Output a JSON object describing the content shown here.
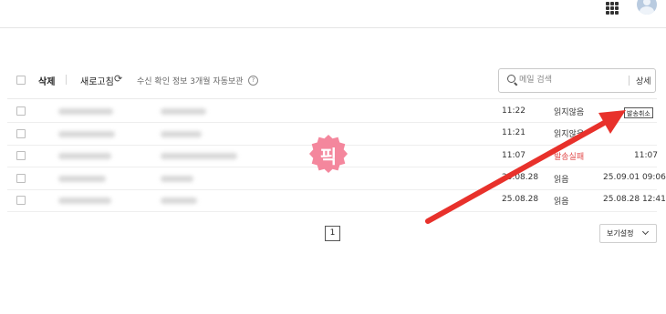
{
  "toolbar": {
    "delete_label": "삭제",
    "refresh_label": "새로고침",
    "refresh_icon": "⟳",
    "info_text": "수신 확인 정보 3개월 자동보관",
    "help_icon": "?"
  },
  "search": {
    "placeholder": "메일 검색",
    "detail_label": "상세"
  },
  "rows": [
    {
      "time": "11:22",
      "status": "읽지않음",
      "read_time": "",
      "action": "발송취소"
    },
    {
      "time": "11:21",
      "status": "읽지않음",
      "read_time": ""
    },
    {
      "time": "11:07",
      "status": "발송실패",
      "read_time": "11:07"
    },
    {
      "time": "25.08.28",
      "status": "읽음",
      "read_time": "25.09.01 09:06"
    },
    {
      "time": "25.08.28",
      "status": "읽음",
      "read_time": "25.08.28 12:41"
    }
  ],
  "badge": {
    "text": "픽"
  },
  "pagination": {
    "current_page": "1"
  },
  "view_settings": {
    "label": "보기설정"
  },
  "colors": {
    "accent_red": "#e8312b",
    "fail_red": "#e24a4a",
    "badge_pink": "#f4879d"
  }
}
